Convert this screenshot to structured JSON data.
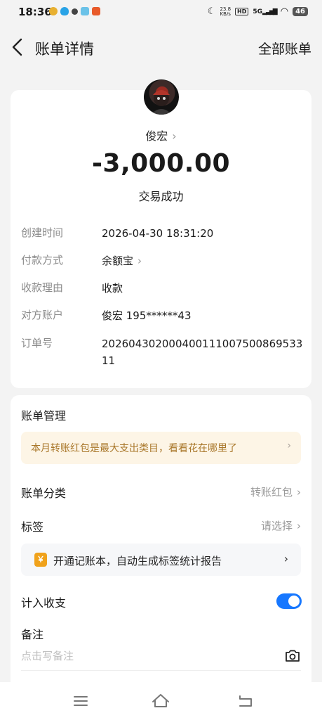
{
  "status_bar": {
    "time": "18:36",
    "net_speed": "23.8",
    "net_unit": "KB/s",
    "hd": "HD",
    "signal": "5G",
    "battery": "46"
  },
  "header": {
    "title": "账单详情",
    "all_bills": "全部账单"
  },
  "transaction": {
    "payee": "俊宏",
    "amount": "-3,000.00",
    "status": "交易成功"
  },
  "details": [
    {
      "label": "创建时间",
      "value": "2026-04-30 18:31:20"
    },
    {
      "label": "付款方式",
      "value": "余额宝"
    },
    {
      "label": "收款理由",
      "value": "收款"
    },
    {
      "label": "对方账户",
      "value": "俊宏 195******43"
    },
    {
      "label": "订单号",
      "value": "20260430200040011100750086953311"
    }
  ],
  "management": {
    "title": "账单管理",
    "promo": "本月转账红包是最大支出类目，看看花在哪里了",
    "category_label": "账单分类",
    "category_value": "转账红包",
    "tag_label": "标签",
    "tag_value": "请选择",
    "ledger_icon_text": "￥",
    "ledger_promo": "开通记账本，自动生成标签统计报告",
    "include_label": "计入收支",
    "include_enabled": true,
    "remark_label": "备注",
    "remark_placeholder": "点击写备注"
  },
  "colors": {
    "accent": "#1677ff",
    "promo_text": "#a9772a",
    "promo_bg": "#fdf5e6"
  }
}
